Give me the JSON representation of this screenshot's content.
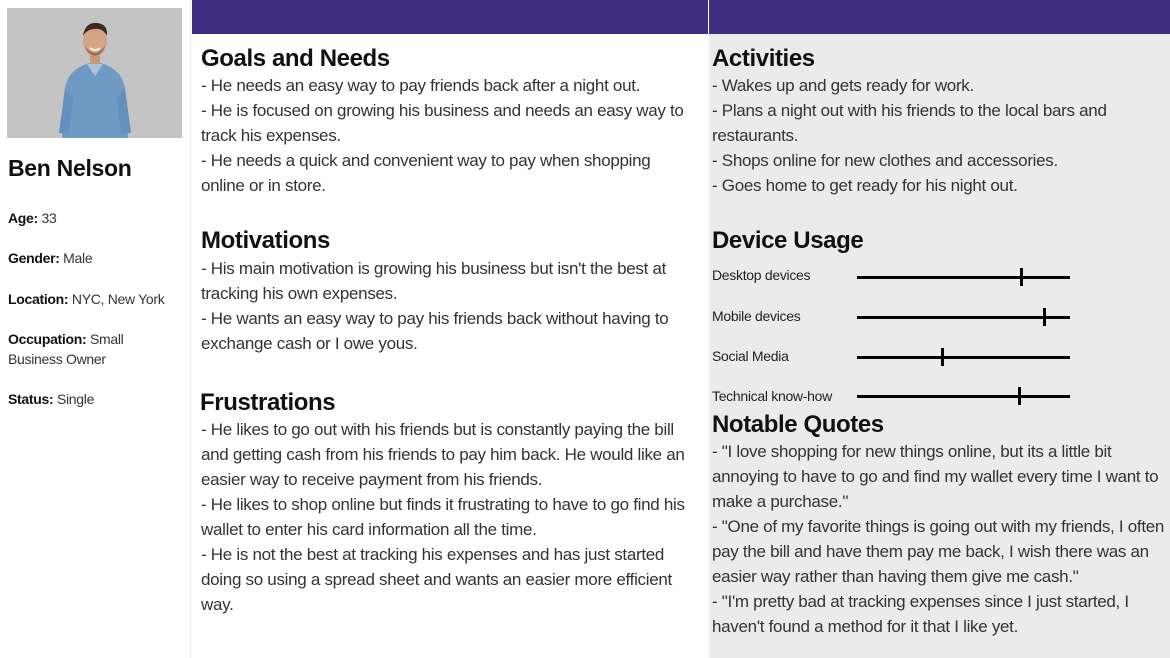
{
  "persona": {
    "name": "Ben Nelson",
    "age_label": "Age:",
    "age": "33",
    "gender_label": "Gender:",
    "gender": "Male",
    "location_label": "Location:",
    "location": "NYC, New York",
    "occupation_label": "Occupation:",
    "occupation": "Small Business Owner",
    "status_label": "Status:",
    "status": "Single"
  },
  "goals": {
    "title": "Goals and Needs",
    "items": [
      " - He needs an easy way to pay friends back after a night out.",
      " - He is focused on growing his business and needs an easy way to track his expenses.",
      " - He needs a quick and convenient way to pay when shopping online or in store."
    ]
  },
  "motivations": {
    "title": "Motivations",
    "items": [
      " - His main motivation is growing his business but isn't the best at tracking his own expenses.",
      " - He wants an easy way to pay his friends back without having to exchange cash or I owe yous."
    ]
  },
  "frustrations": {
    "title": "Frustrations",
    "items": [
      " - He likes to go out with his friends but is constantly paying the bill and getting cash from his friends to pay him back. He would like an easier way to receive payment from his friends.",
      " - He likes to shop online but finds it frustrating to have to go find his wallet to enter his card information all the time.",
      " - He is not the best at tracking his expenses and has just started doing so using a spread sheet and wants an easier more efficient way."
    ]
  },
  "activities": {
    "title": "Activities",
    "items": [
      "- Wakes up and gets ready for work.",
      "- Plans a night out with his friends to the local bars and restaurants.",
      "- Shops online for new clothes and accessories.",
      "- Goes home to get ready for his night out."
    ]
  },
  "device_usage": {
    "title": "Device Usage",
    "items": [
      {
        "label": "Desktop devices",
        "level": 0.77
      },
      {
        "label": "Mobile devices",
        "level": 0.88
      },
      {
        "label": "Social Media",
        "level": 0.4
      },
      {
        "label": "Technical know-how",
        "level": 0.76
      }
    ]
  },
  "quotes": {
    "title": "Notable Quotes",
    "items": [
      "- \"I love shopping for new things online, but its a little bit annoying to have to go and find my wallet every time I want to make a purchase.\"",
      "- \"One of my favorite things is going out with my friends, I often pay the bill and have them pay me back, I wish there was an easier way rather than having them give me cash.\"",
      "- \"I'm pretty bad at tracking expenses since I just started, I haven't found a method for it that I like yet."
    ]
  },
  "colors": {
    "header_bar": "#3f2d82",
    "gray_panel": "#ebebeb"
  }
}
